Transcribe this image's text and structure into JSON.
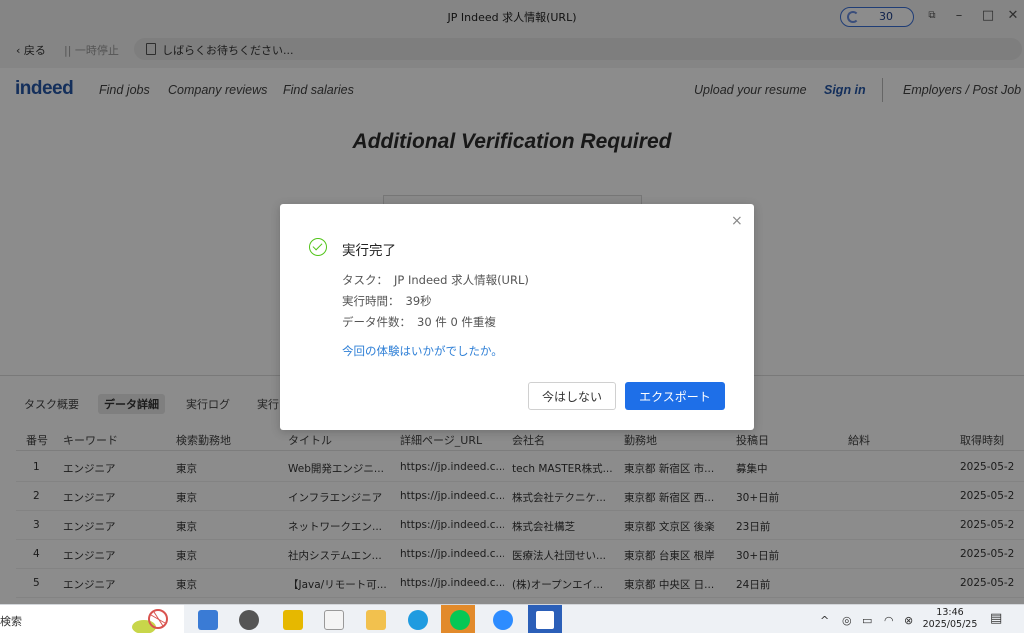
{
  "window": {
    "title": "JP Indeed 求人情報(URL)",
    "badge_count": "30",
    "minimize": "–",
    "maximize": "□",
    "close": "✕"
  },
  "toolbar": {
    "back_label": "‹ 戻る",
    "pause_label": "|| 一時停止",
    "url_text": "しばらくお待ちください..."
  },
  "site": {
    "logo": "indeed",
    "nav": [
      "Find jobs",
      "Company reviews",
      "Find salaries"
    ],
    "upload_resume": "Upload your resume",
    "sign_in": "Sign in",
    "employers": "Employers / Post Job",
    "heading": "Additional Verification Required"
  },
  "panel": {
    "tabs": [
      "タスク概要",
      "データ詳細",
      "実行ログ",
      "実行"
    ],
    "active_tab": "データ詳細",
    "columns": [
      "番号",
      "キーワード",
      "検索勤務地",
      "タイトル",
      "詳細ページ_URL",
      "会社名",
      "勤務地",
      "投稿日",
      "給料",
      "取得時刻"
    ],
    "rows": [
      [
        "1",
        "エンジニア",
        "東京",
        "Web開発エンジニ...",
        "https://jp.indeed.c...",
        "tech MASTER株式...",
        "東京都 新宿区 市...",
        "募集中",
        "",
        "2025-05-2"
      ],
      [
        "2",
        "エンジニア",
        "東京",
        "インフラエンジニア",
        "https://jp.indeed.c...",
        "株式会社テクニケ...",
        "東京都 新宿区 西...",
        "30+日前",
        "",
        "2025-05-2"
      ],
      [
        "3",
        "エンジニア",
        "東京",
        "ネットワークエン...",
        "https://jp.indeed.c...",
        "株式会社構芝",
        "東京都 文京区 後楽",
        "23日前",
        "",
        "2025-05-2"
      ],
      [
        "4",
        "エンジニア",
        "東京",
        "社内システムエン...",
        "https://jp.indeed.c...",
        "医療法人社団せい...",
        "東京都 台東区 根岸",
        "30+日前",
        "",
        "2025-05-2"
      ],
      [
        "5",
        "エンジニア",
        "東京",
        "【Java/リモート可...",
        "https://jp.indeed.c...",
        "(株)オープンエイ...",
        "東京都 中央区 日...",
        "24日前",
        "",
        "2025-05-2"
      ]
    ]
  },
  "dialog": {
    "close": "×",
    "title": "実行完了",
    "task_label": "タスク：",
    "task_value": "JP Indeed 求人情報(URL)",
    "time_label": "実行時間：",
    "time_value": "39秒",
    "count_label": "データ件数：",
    "count_value": "30 件 0 件重複",
    "feedback": "今回の体験はいかがでしたか。",
    "later_button": "今はしない",
    "export_button": "エクスポート"
  },
  "taskbar": {
    "search_text": "検索",
    "time": "13:46",
    "date": "2025/05/25"
  },
  "colors": {
    "accent": "#1e6fe8",
    "success": "#52c41a",
    "indeed_blue": "#2557a7"
  }
}
